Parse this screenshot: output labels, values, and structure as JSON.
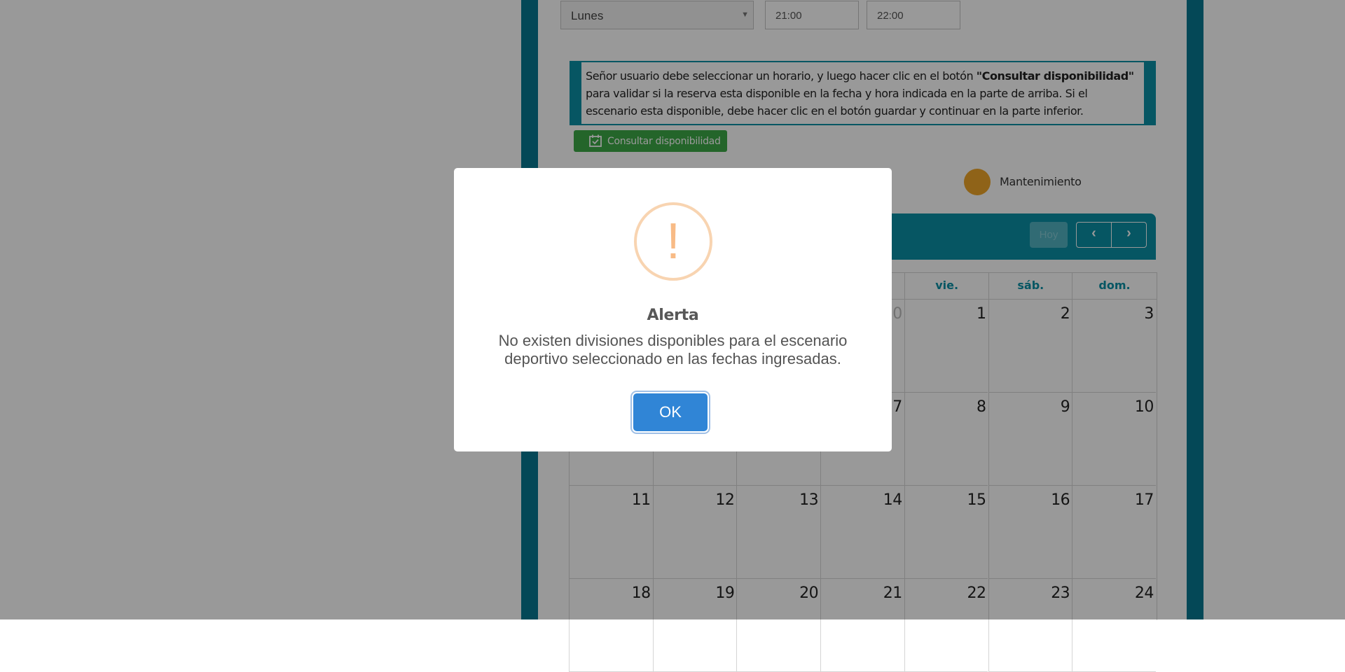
{
  "form": {
    "day_select": "Lunes",
    "start_time": "21:00",
    "end_time": "22:00"
  },
  "info": {
    "text_before": "Señor usuario debe seleccionar un horario, y luego hacer clic en el botón ",
    "text_bold": "\"Consultar disponibilidad\"",
    "text_after": " para validar si la reserva esta disponible en la fecha y hora indicada en la parte de arriba. Si el escenario esta disponible, debe hacer clic en el botón guardar y continuar en la parte inferior."
  },
  "consult_button_label": "Consultar disponibilidad",
  "legend": {
    "label": "Mantenimiento",
    "color": "#efa628"
  },
  "calendar": {
    "today_label": "Hoy",
    "prev_label": "‹",
    "next_label": "›",
    "day_headers": [
      "",
      "",
      "",
      "",
      "vie.",
      "sáb.",
      "dom."
    ],
    "weeks": [
      [
        "",
        "",
        "",
        "30",
        "1",
        "2",
        "3"
      ],
      [
        "",
        "",
        "",
        "7",
        "8",
        "9",
        "10"
      ],
      [
        "11",
        "12",
        "13",
        "14",
        "15",
        "16",
        "17"
      ],
      [
        "18",
        "19",
        "20",
        "21",
        "22",
        "23",
        "24"
      ]
    ]
  },
  "colors": {
    "brand_teal": "#0b8fa6",
    "success_green": "#3ca846",
    "ok_blue": "#3085d6",
    "warning_orange": "#f8bb86"
  },
  "alert": {
    "icon": "warning-icon",
    "icon_glyph": "!",
    "title": "Alerta",
    "message": "No existen divisiones disponibles para el escenario deportivo seleccionado en las fechas ingresadas.",
    "ok_label": "OK"
  }
}
